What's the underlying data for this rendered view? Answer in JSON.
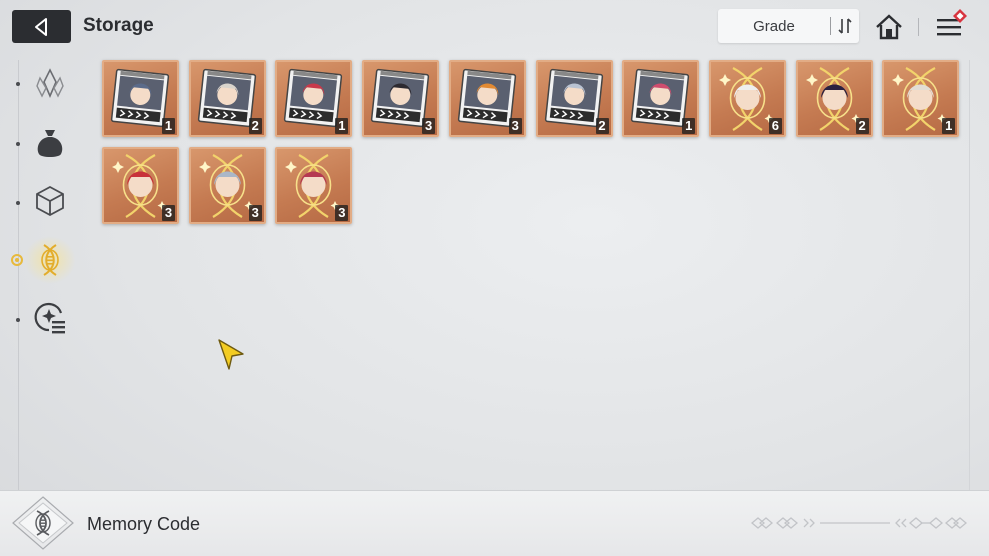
{
  "header": {
    "title": "Storage",
    "sort_label": "Grade"
  },
  "sidebar": {
    "items": [
      {
        "icon": "crystal-icon",
        "active": false
      },
      {
        "icon": "pouch-icon",
        "active": false
      },
      {
        "icon": "cube-icon",
        "active": false
      },
      {
        "icon": "memory-code-icon",
        "active": true
      },
      {
        "icon": "disc-list-icon",
        "active": false
      }
    ]
  },
  "items": [
    {
      "type": "card",
      "count": "1"
    },
    {
      "type": "card",
      "count": "2"
    },
    {
      "type": "card",
      "count": "1"
    },
    {
      "type": "card",
      "count": "3"
    },
    {
      "type": "card",
      "count": "3"
    },
    {
      "type": "card",
      "count": "2"
    },
    {
      "type": "card",
      "count": "1"
    },
    {
      "type": "memory",
      "count": "6"
    },
    {
      "type": "memory",
      "count": "2"
    },
    {
      "type": "memory",
      "count": "1"
    },
    {
      "type": "memory",
      "count": "3"
    },
    {
      "type": "memory",
      "count": "3"
    },
    {
      "type": "memory",
      "count": "3"
    }
  ],
  "footer": {
    "category_label": "Memory Code"
  },
  "colors": {
    "tile": "#c57b52",
    "accent_gold": "#e7b93c",
    "badge_red": "#d8343f"
  }
}
